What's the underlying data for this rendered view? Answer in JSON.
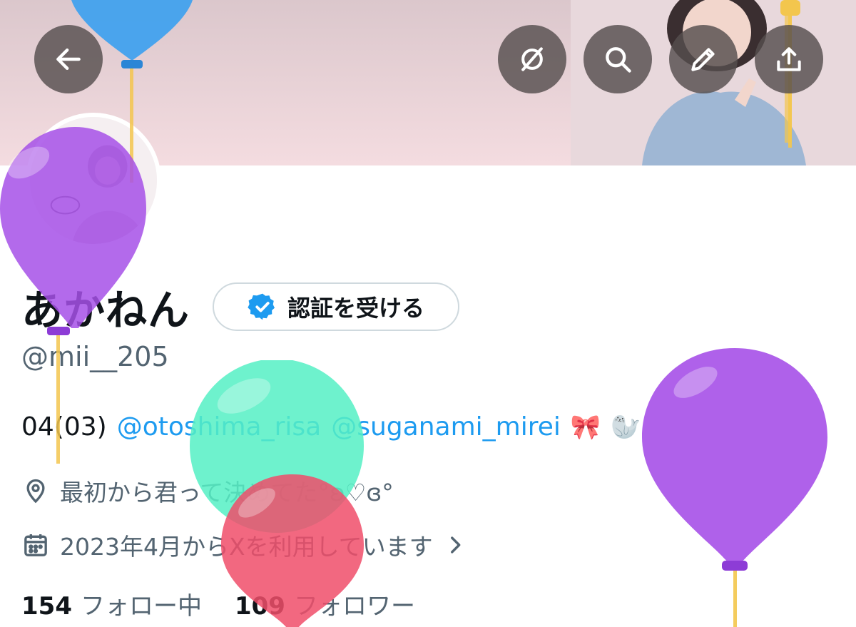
{
  "profile": {
    "display_name": "あかねん",
    "verify_label": "認証を受ける",
    "handle": "@mii__205",
    "bio": {
      "prefix": "04(03)",
      "mentions": [
        "@otoshima_risa",
        "@suganami_mirei"
      ],
      "emojis": [
        "🎀",
        "🦭"
      ]
    },
    "location": "最初から君って決めてた°ʚ♡ɞ°",
    "joined": "2023年4月からXを利用しています",
    "following_count": "154",
    "following_label": "フォロー中",
    "followers_count": "109",
    "followers_label": "フォロワー"
  },
  "header_buttons": {
    "back": "arrow-left-icon",
    "toggle": "circle-slash-icon",
    "search": "search-icon",
    "edit": "pencil-icon",
    "share": "share-upload-icon"
  },
  "colors": {
    "accent": "#1d9bf0",
    "verified_badge": "#1d9bf0",
    "balloon_purple": "#a650e8",
    "balloon_green": "#55f0c4",
    "balloon_red": "#f04d6a",
    "balloon_blue": "#3aa0f0"
  }
}
